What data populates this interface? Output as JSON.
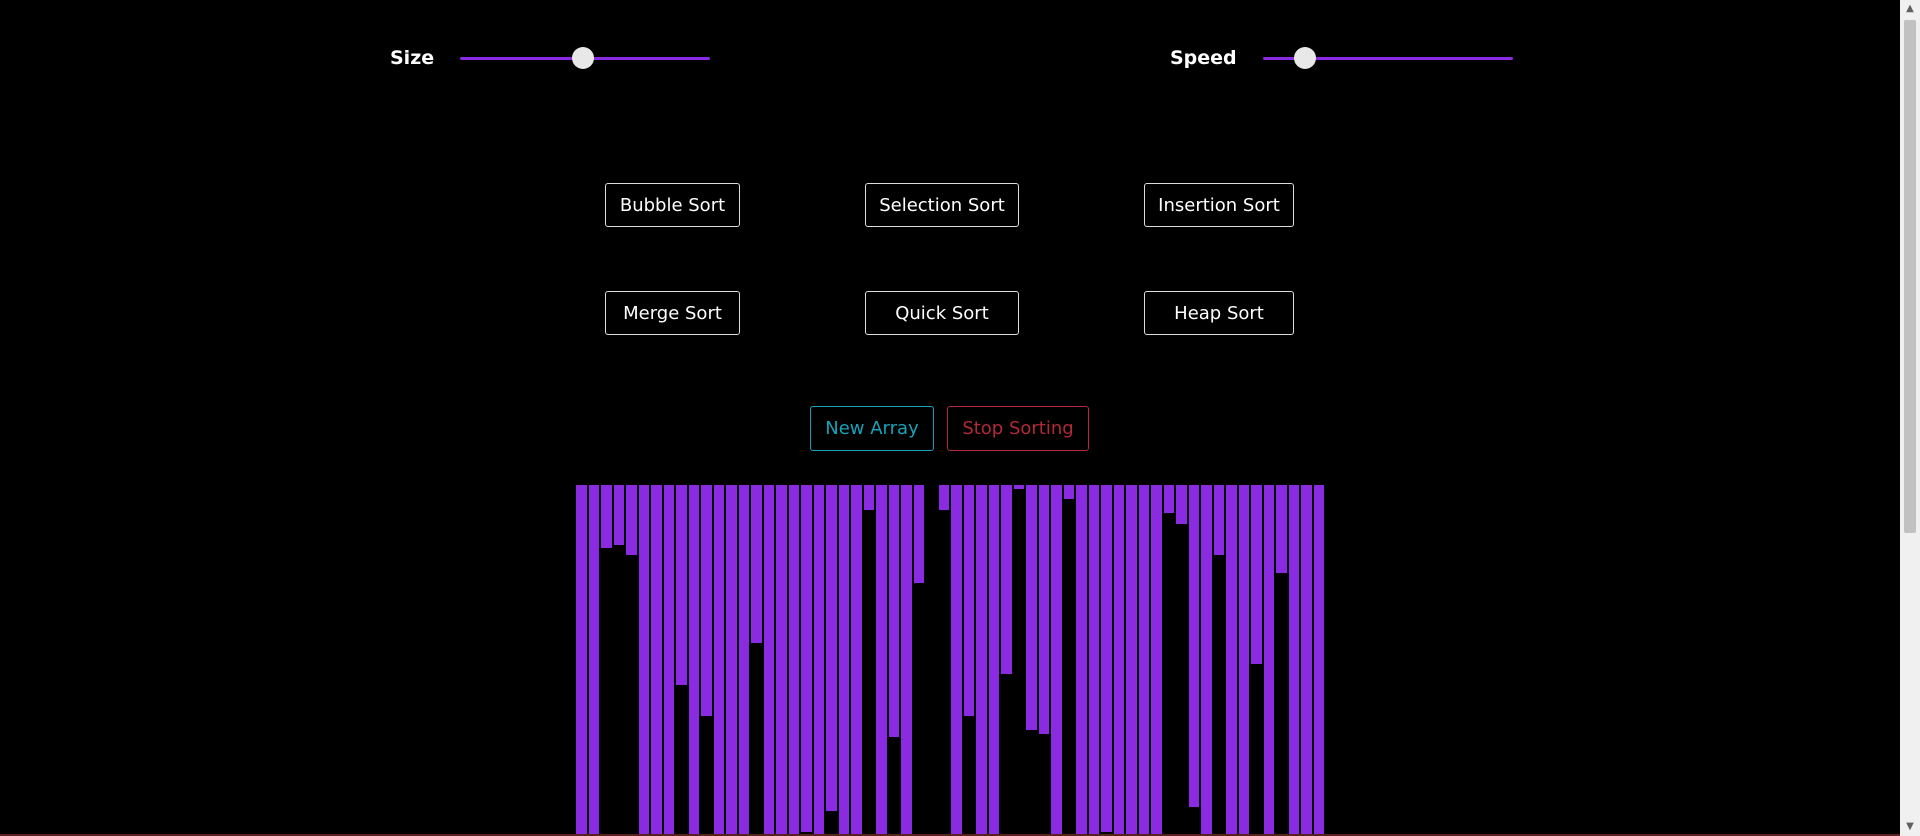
{
  "sliders": {
    "size": {
      "label": "Size",
      "value_fraction": 0.49
    },
    "speed": {
      "label": "Speed",
      "value_fraction": 0.17
    }
  },
  "algorithms": {
    "bubble": "Bubble Sort",
    "selection": "Selection Sort",
    "insertion": "Insertion Sort",
    "merge": "Merge Sort",
    "quick": "Quick Sort",
    "heap": "Heap Sort"
  },
  "controls": {
    "new_array": "New Array",
    "stop_sorting": "Stop Sorting"
  },
  "colors": {
    "bar": "#8a2be2",
    "accent": "#8a2be2",
    "new_array": "#17a2b8",
    "stop_sorting": "#b02a37",
    "button_border": "#dcdcdc"
  },
  "icons": {
    "scroll_up": "scroll-up-arrow-icon",
    "scroll_down": "scroll-down-arrow-icon"
  },
  "bars": {
    "description": "bar lengths as fraction of max (bars hang from top)",
    "values": [
      1.0,
      1.0,
      0.18,
      0.17,
      0.2,
      1.0,
      1.0,
      1.0,
      0.57,
      1.0,
      0.66,
      1.0,
      1.0,
      1.0,
      0.45,
      1.0,
      1.0,
      1.0,
      0.99,
      1.0,
      0.93,
      1.0,
      1.0,
      0.07,
      1.0,
      0.72,
      1.0,
      0.28,
      0.0,
      0.07,
      1.0,
      0.66,
      1.0,
      1.0,
      0.54,
      0.01,
      0.7,
      0.71,
      1.0,
      0.04,
      1.0,
      1.0,
      0.99,
      1.0,
      1.0,
      1.0,
      1.0,
      0.08,
      0.11,
      0.92,
      1.0,
      0.2,
      1.0,
      1.0,
      0.51,
      1.0,
      0.25,
      1.0,
      1.0,
      1.0
    ]
  }
}
